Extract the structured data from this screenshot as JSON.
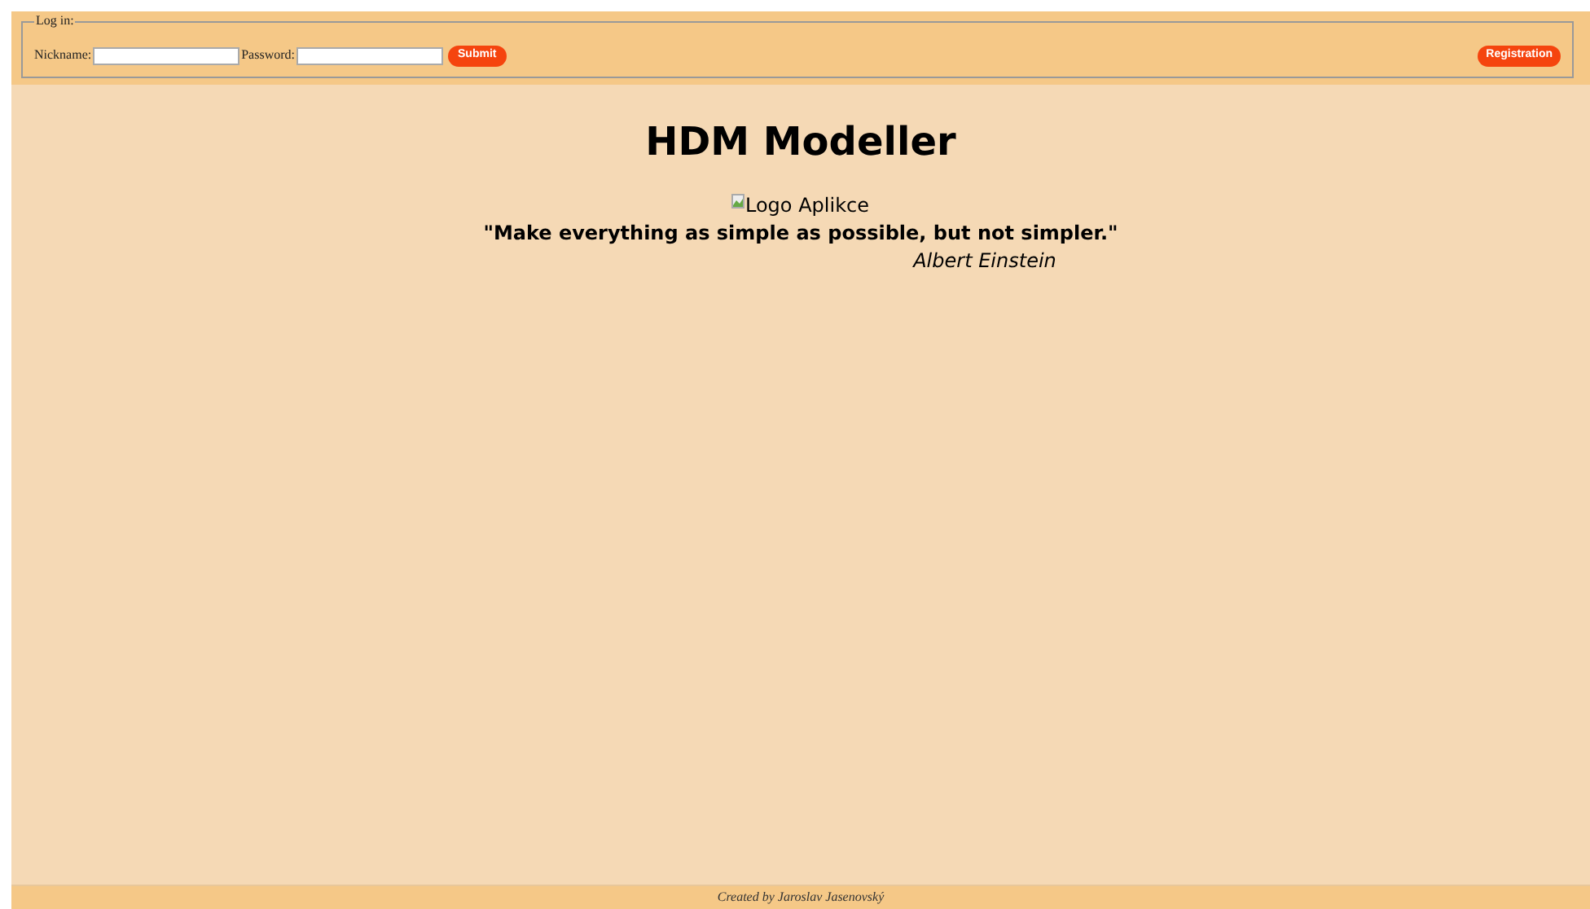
{
  "login": {
    "legend": "Log in:",
    "nickname_label": "Nickname:",
    "password_label": "Password:",
    "submit": "Submit"
  },
  "registration": "Registration",
  "title": "HDM Modeller",
  "logo_alt": "Logo Aplikce",
  "quote": "\"Make everything as simple as possible, but not simpler.\"",
  "author": "Albert Einstein",
  "footer": "Created by Jaroslav Jasenovský"
}
